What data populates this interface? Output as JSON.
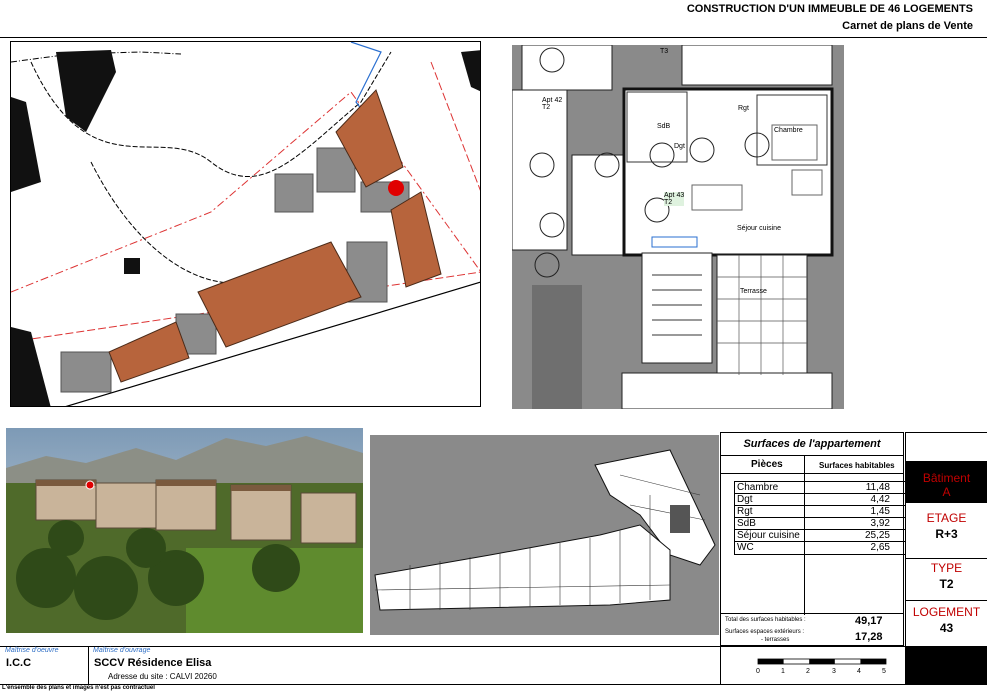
{
  "header": {
    "title": "CONSTRUCTION D'UN IMMEUBLE DE 46 LOGEMENTS",
    "subtitle": "Carnet de plans de Vente"
  },
  "site_plan": {
    "marker_color": "#e00000"
  },
  "floor_plan": {
    "apt_a": "Apt 42",
    "apt_a_type": "T2",
    "apt_b": "Apt 43",
    "apt_b_type": "T2",
    "tag_t3": "T3",
    "room_rgt": "Rgt",
    "room_chambre": "Chambre",
    "room_sejour": "Séjour cuisine",
    "room_terrasse": "Terrasse",
    "room_dgt": "Dgt",
    "room_sdb": "SdB"
  },
  "surfaces": {
    "title": "Surfaces de l'appartement",
    "col_pieces": "Pièces",
    "col_surfaces": "Surfaces habitables",
    "rows": [
      {
        "name": "Chambre",
        "value": "11,48"
      },
      {
        "name": "Dgt",
        "value": "4,42"
      },
      {
        "name": "Rgt",
        "value": "1,45"
      },
      {
        "name": "SdB",
        "value": "3,92"
      },
      {
        "name": "Séjour cuisine",
        "value": "25,25"
      },
      {
        "name": "WC",
        "value": "2,65"
      }
    ],
    "total_label": "Total des surfaces habitables :",
    "total_value": "49,17",
    "ext_label": "Surfaces espaces extérieurs :",
    "ext_sub": "- terrasses",
    "ext_value": "17,28"
  },
  "side": {
    "batiment_label": "Bâtiment",
    "batiment_value": "A",
    "etage_label": "ETAGE",
    "etage_value": "R+3",
    "type_label": "TYPE",
    "type_value": "T2",
    "logement_label": "LOGEMENT",
    "logement_value": "43"
  },
  "footer": {
    "moe_label": "Maîtrise d'oeuvre",
    "moe_value": "I.C.C",
    "mou_label": "Maîtrise d'ouvrage",
    "mou_value": "SCCV Résidence Elisa",
    "address": "Adresse du site : CALVI 20260",
    "disclaimer": "L'ensemble des plans et images n'est pas contractuel",
    "scale_ticks": [
      "0",
      "1",
      "2",
      "3",
      "4",
      "5"
    ]
  }
}
